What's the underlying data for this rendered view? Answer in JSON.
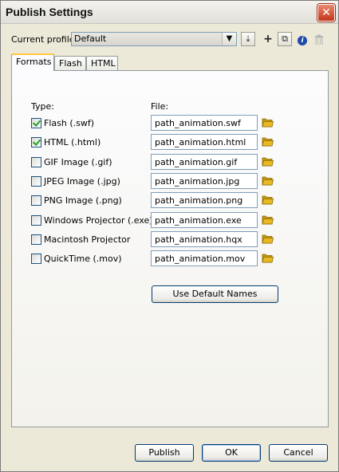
{
  "window": {
    "title": "Publish Settings",
    "close_glyph": "✕"
  },
  "profile": {
    "label": "Current profile:",
    "selected": "Default",
    "toolbar": [
      {
        "name": "import-export-icon",
        "glyph": "⤓"
      },
      {
        "name": "add-profile-icon",
        "glyph": "+"
      },
      {
        "name": "duplicate-profile-icon",
        "glyph": "⧉"
      },
      {
        "name": "profile-info-icon",
        "glyph": "i"
      },
      {
        "name": "delete-profile-icon",
        "glyph": "🗑"
      }
    ]
  },
  "tabs": [
    "Formats",
    "Flash",
    "HTML"
  ],
  "formats": {
    "type_header": "Type:",
    "file_header": "File:",
    "rows": [
      {
        "label": "Flash  (.swf)",
        "file": "path_animation.swf",
        "checked": true
      },
      {
        "label": "HTML  (.html)",
        "file": "path_animation.html",
        "checked": true
      },
      {
        "label": "GIF Image  (.gif)",
        "file": "path_animation.gif",
        "checked": false
      },
      {
        "label": "JPEG Image  (.jpg)",
        "file": "path_animation.jpg",
        "checked": false
      },
      {
        "label": "PNG Image  (.png)",
        "file": "path_animation.png",
        "checked": false
      },
      {
        "label": "Windows Projector  (.exe)",
        "file": "path_animation.exe",
        "checked": false
      },
      {
        "label": "Macintosh Projector",
        "file": "path_animation.hqx",
        "checked": false
      },
      {
        "label": "QuickTime  (.mov)",
        "file": "path_animation.mov",
        "checked": false
      }
    ],
    "default_names_button": "Use Default Names"
  },
  "buttons": {
    "publish": "Publish",
    "ok": "OK",
    "cancel": "Cancel"
  },
  "colors": {
    "title_bar_close": "#c2351a",
    "tab_highlight": "#ffc83c",
    "check_mark": "#21a121",
    "folder": "#e8b923"
  }
}
